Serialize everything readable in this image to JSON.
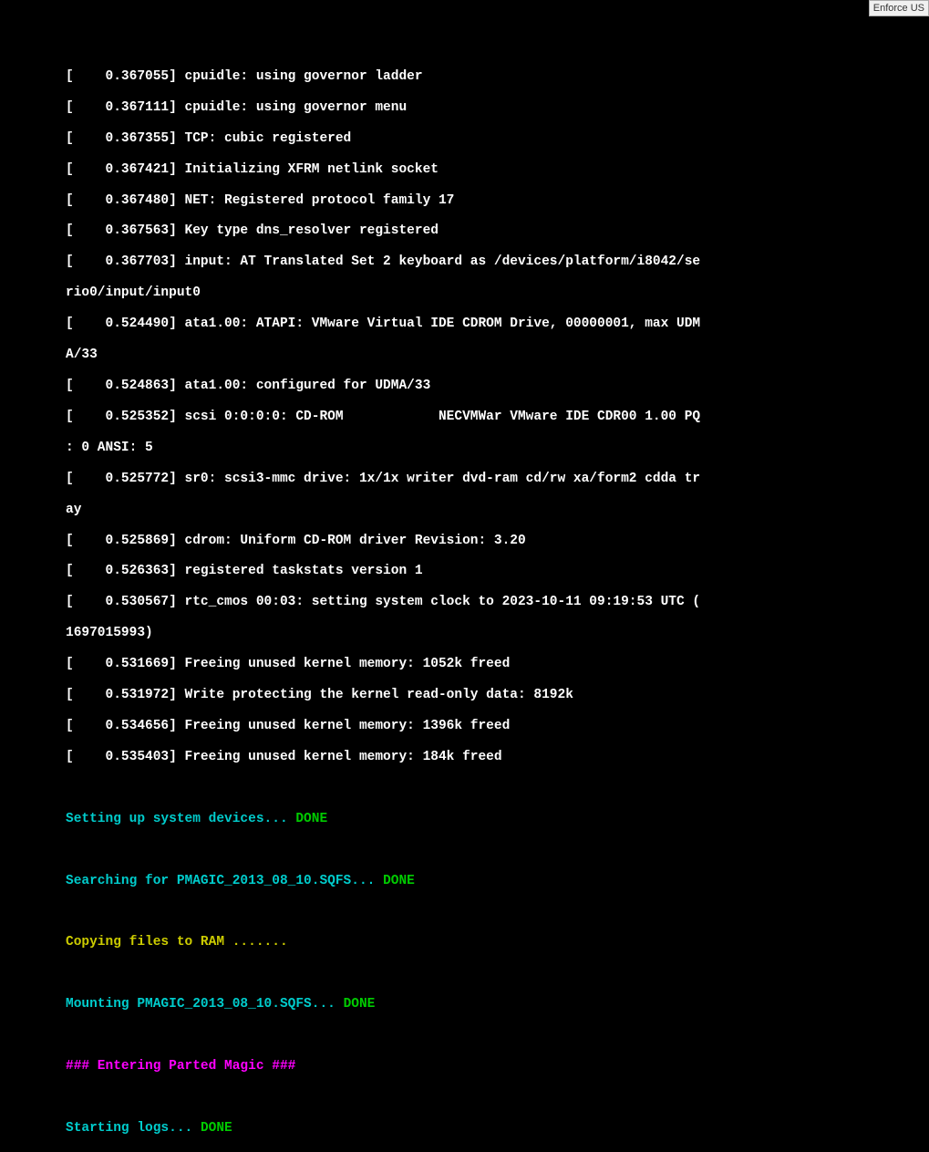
{
  "enforce_label": "Enforce US",
  "kernel_lines": [
    "[    0.367055] cpuidle: using governor ladder",
    "[    0.367111] cpuidle: using governor menu",
    "[    0.367355] TCP: cubic registered",
    "[    0.367421] Initializing XFRM netlink socket",
    "[    0.367480] NET: Registered protocol family 17",
    "[    0.367563] Key type dns_resolver registered",
    "[    0.367703] input: AT Translated Set 2 keyboard as /devices/platform/i8042/se",
    "rio0/input/input0",
    "[    0.524490] ata1.00: ATAPI: VMware Virtual IDE CDROM Drive, 00000001, max UDM",
    "A/33",
    "[    0.524863] ata1.00: configured for UDMA/33",
    "[    0.525352] scsi 0:0:0:0: CD-ROM            NECVMWar VMware IDE CDR00 1.00 PQ",
    ": 0 ANSI: 5",
    "[    0.525772] sr0: scsi3-mmc drive: 1x/1x writer dvd-ram cd/rw xa/form2 cdda tr",
    "ay",
    "[    0.525869] cdrom: Uniform CD-ROM driver Revision: 3.20",
    "[    0.526363] registered taskstats version 1",
    "[    0.530567] rtc_cmos 00:03: setting system clock to 2023-10-11 09:19:53 UTC (",
    "1697015993)",
    "[    0.531669] Freeing unused kernel memory: 1052k freed",
    "[    0.531972] Write protecting the kernel read-only data: 8192k",
    "[    0.534656] Freeing unused kernel memory: 1396k freed",
    "[    0.535403] Freeing unused kernel memory: 184k freed"
  ],
  "status": {
    "setup_devices": "Setting up system devices... ",
    "setup_devices_done": "DONE",
    "searching": "Searching for PMAGIC_2013_08_10.SQFS... ",
    "searching_done": "DONE",
    "copying": "Copying files to RAM .......",
    "mounting": "Mounting PMAGIC_2013_08_10.SQFS... ",
    "mounting_done": "DONE",
    "entering": "### Entering Parted Magic ###",
    "starting_logs": "Starting logs... ",
    "starting_logs_done": "DONE"
  }
}
